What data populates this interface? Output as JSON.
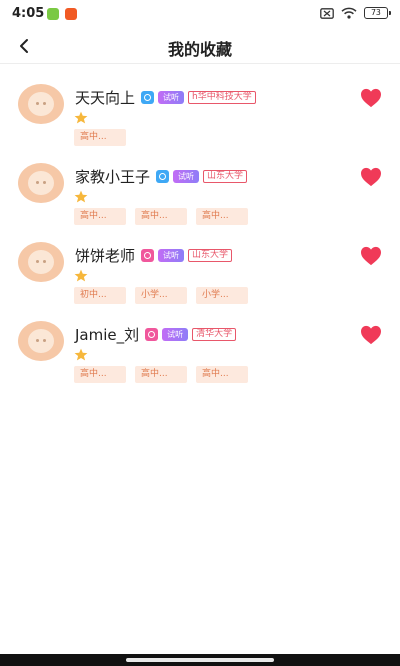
{
  "status_bar": {
    "time": "4:05",
    "battery": "73",
    "app_icon_colors": [
      "#7ac943",
      "#f15a24"
    ]
  },
  "header": {
    "title": "我的收藏",
    "back_icon": "chevron-left-icon"
  },
  "colors": {
    "accent_heart": "#f03a58",
    "tag_bg": "#fde9de",
    "tag_text": "#e07a4e",
    "school_badge": "#e8576a",
    "star": "#f6b73c"
  },
  "favorites": [
    {
      "name": "天天向上",
      "gender": "male",
      "trial_label": "试听",
      "school": "h华中科技大学",
      "rating_stars": 1,
      "tags": [
        "高中..."
      ],
      "favorited": true
    },
    {
      "name": "家教小王子",
      "gender": "male",
      "trial_label": "试听",
      "school": "山东大学",
      "rating_stars": 1,
      "tags": [
        "高中...",
        "高中...",
        "高中..."
      ],
      "favorited": true
    },
    {
      "name": "饼饼老师",
      "gender": "female",
      "trial_label": "试听",
      "school": "山东大学",
      "rating_stars": 1,
      "tags": [
        "初中...",
        "小学...",
        "小学..."
      ],
      "favorited": true
    },
    {
      "name": "Jamie_刘",
      "gender": "female",
      "trial_label": "试听",
      "school": "清华大学",
      "rating_stars": 1,
      "tags": [
        "高中...",
        "高中...",
        "高中..."
      ],
      "favorited": true
    }
  ]
}
